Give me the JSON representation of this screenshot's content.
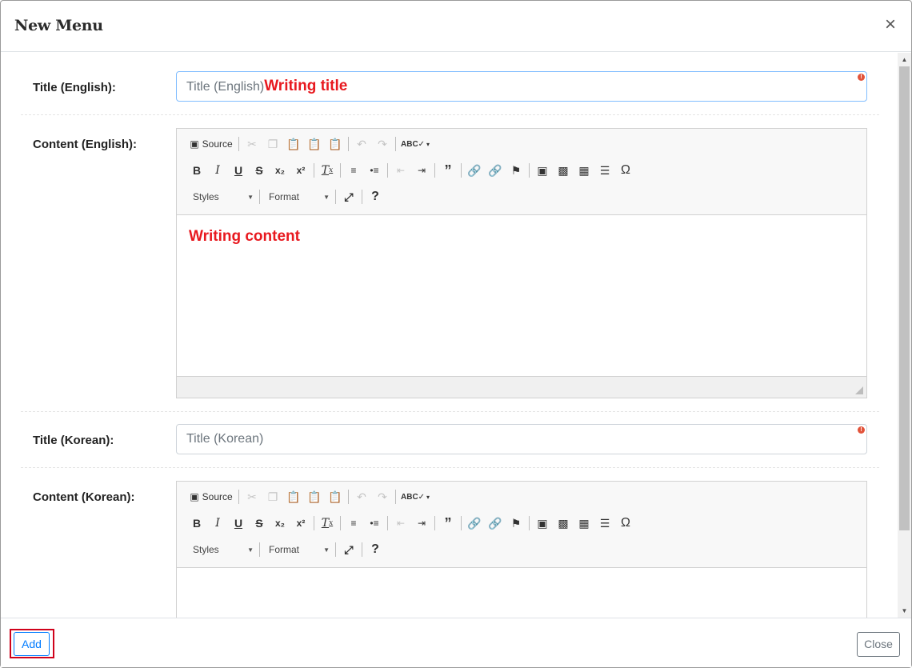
{
  "modal": {
    "title": "New Menu",
    "close_glyph": "×"
  },
  "fields": {
    "title_en": {
      "label": "Title (English):",
      "placeholder": "Title (English)",
      "annotation": "Writing title"
    },
    "content_en": {
      "label": "Content (English):",
      "annotation": "Writing content"
    },
    "title_ko": {
      "label": "Title (Korean):",
      "placeholder": "Title (Korean)"
    },
    "content_ko": {
      "label": "Content (Korean):"
    }
  },
  "toolbar": {
    "source_label": "Source",
    "styles_label": "Styles",
    "format_label": "Format",
    "icons": {
      "source": "source-icon",
      "cut": "cut-icon",
      "copy": "copy-icon",
      "paste": "paste-icon",
      "paste_text": "paste-text-icon",
      "paste_word": "paste-from-word-icon",
      "undo": "undo-icon",
      "redo": "redo-icon",
      "spellcheck": "spellcheck-icon",
      "bold": "B",
      "italic": "I",
      "underline": "U",
      "strike": "S",
      "subscript": "x₂",
      "superscript": "x²",
      "remove_format": "Tx",
      "numbered_list": "numbered-list-icon",
      "bulleted_list": "bulleted-list-icon",
      "outdent": "outdent-icon",
      "indent": "indent-icon",
      "blockquote": "99",
      "link": "link-icon",
      "unlink": "unlink-icon",
      "anchor": "flag-icon",
      "image": "image-icon",
      "iframe": "iframe-icon",
      "table": "table-icon",
      "hr": "horizontal-line-icon",
      "special_char": "Ω",
      "maximize": "maximize-icon",
      "help": "?"
    }
  },
  "footer": {
    "add_label": "Add",
    "close_label": "Close"
  },
  "colors": {
    "annotation_red": "#e8191f",
    "primary_blue": "#007bff",
    "secondary_gray": "#6c757d",
    "highlight_box": "#d0021b"
  }
}
